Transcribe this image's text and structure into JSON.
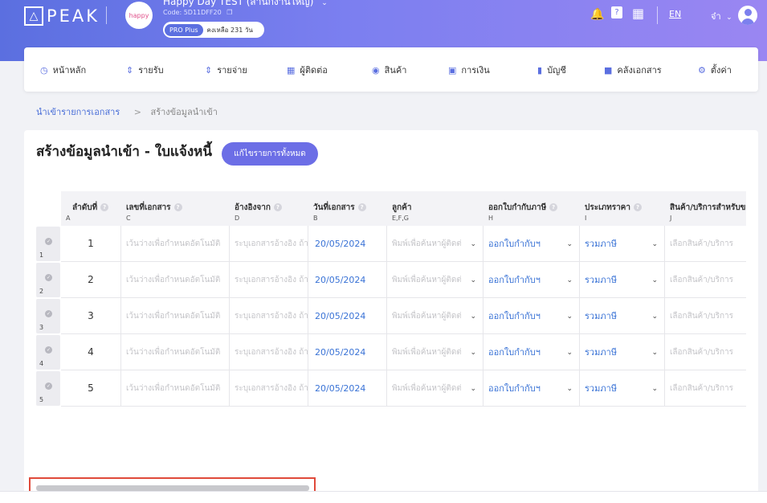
{
  "header": {
    "logo_text": "PEAK",
    "company_name": "Happy Day TEST (สำนักงานใหญ่)",
    "company_code": "Code: 5D11DFF20",
    "plan_label": "PRO Plus",
    "plan_remaining": "คงเหลือ 231 วัน",
    "lang": "EN",
    "user_name": "จ๋า"
  },
  "nav": {
    "items": [
      {
        "label": "หน้าหลัก",
        "icon": "dashboard-icon"
      },
      {
        "label": "รายรับ",
        "icon": "income-icon"
      },
      {
        "label": "รายจ่าย",
        "icon": "expense-icon"
      },
      {
        "label": "ผู้ติดต่อ",
        "icon": "contacts-icon"
      },
      {
        "label": "สินค้า",
        "icon": "product-box-icon"
      },
      {
        "label": "การเงิน",
        "icon": "money-icon"
      },
      {
        "label": "บัญชี",
        "icon": "ledger-icon"
      },
      {
        "label": "คลังเอกสาร",
        "icon": "folder-icon"
      },
      {
        "label": "ตั้งค่า",
        "icon": "gear-icon"
      }
    ]
  },
  "breadcrumb": {
    "parent": "นำเข้ารายการเอกสาร",
    "separator": ">",
    "current": "สร้างข้อมูลนำเข้า"
  },
  "page": {
    "title": "สร้างข้อมูลนำเข้า - ใบแจ้งหนี้",
    "edit_all_button": "แก้ไขรายการทั้งหมด"
  },
  "table": {
    "columns": [
      {
        "title": "ลำดับที่",
        "code": "A"
      },
      {
        "title": "เลขที่เอกสาร",
        "code": "C"
      },
      {
        "title": "อ้างอิงจาก",
        "code": "D"
      },
      {
        "title": "วันที่เอกสาร",
        "code": "B"
      },
      {
        "title": "ลูกค้า",
        "code": "E,F,G"
      },
      {
        "title": "ออกใบกำกับภาษี",
        "code": "H"
      },
      {
        "title": "ประเภทราคา",
        "code": "I"
      },
      {
        "title": "สินค้า/บริการสำหรับขาย",
        "code": "J"
      }
    ],
    "rows": [
      {
        "row_num": "1",
        "seq": "1",
        "doc_no_placeholder": "เว้นว่างเพื่อกำหนดอัตโนมัติ",
        "ref_placeholder": "ระบุเอกสารอ้างอิง ถ้ามี",
        "date": "20/05/2024",
        "customer_placeholder": "พิมพ์เพื่อค้นหาผู้ติดต่อ",
        "tax_invoice": "ออกใบกำกับฯ",
        "price_type": "รวมภาษี",
        "product_placeholder": "เลือกสินค้า/บริการ"
      },
      {
        "row_num": "2",
        "seq": "2",
        "doc_no_placeholder": "เว้นว่างเพื่อกำหนดอัตโนมัติ",
        "ref_placeholder": "ระบุเอกสารอ้างอิง ถ้ามี",
        "date": "20/05/2024",
        "customer_placeholder": "พิมพ์เพื่อค้นหาผู้ติดต่อ",
        "tax_invoice": "ออกใบกำกับฯ",
        "price_type": "รวมภาษี",
        "product_placeholder": "เลือกสินค้า/บริการ"
      },
      {
        "row_num": "3",
        "seq": "3",
        "doc_no_placeholder": "เว้นว่างเพื่อกำหนดอัตโนมัติ",
        "ref_placeholder": "ระบุเอกสารอ้างอิง ถ้ามี",
        "date": "20/05/2024",
        "customer_placeholder": "พิมพ์เพื่อค้นหาผู้ติดต่อ",
        "tax_invoice": "ออกใบกำกับฯ",
        "price_type": "รวมภาษี",
        "product_placeholder": "เลือกสินค้า/บริการ"
      },
      {
        "row_num": "4",
        "seq": "4",
        "doc_no_placeholder": "เว้นว่างเพื่อกำหนดอัตโนมัติ",
        "ref_placeholder": "ระบุเอกสารอ้างอิง ถ้ามี",
        "date": "20/05/2024",
        "customer_placeholder": "พิมพ์เพื่อค้นหาผู้ติดต่อ",
        "tax_invoice": "ออกใบกำกับฯ",
        "price_type": "รวมภาษี",
        "product_placeholder": "เลือกสินค้า/บริการ"
      },
      {
        "row_num": "5",
        "seq": "5",
        "doc_no_placeholder": "เว้นว่างเพื่อกำหนดอัตโนมัติ",
        "ref_placeholder": "ระบุเอกสารอ้างอิง ถ้ามี",
        "date": "20/05/2024",
        "customer_placeholder": "พิมพ์เพื่อค้นหาผู้ติดต่อ",
        "tax_invoice": "ออกใบกำกับฯ",
        "price_type": "รวมภาษี",
        "product_placeholder": "เลือกสินค้า/บริการ"
      }
    ]
  },
  "colors": {
    "accent": "#5b6fe0",
    "link": "#3a73d6",
    "button": "#6c6ee6",
    "highlight": "#e04a3a"
  }
}
